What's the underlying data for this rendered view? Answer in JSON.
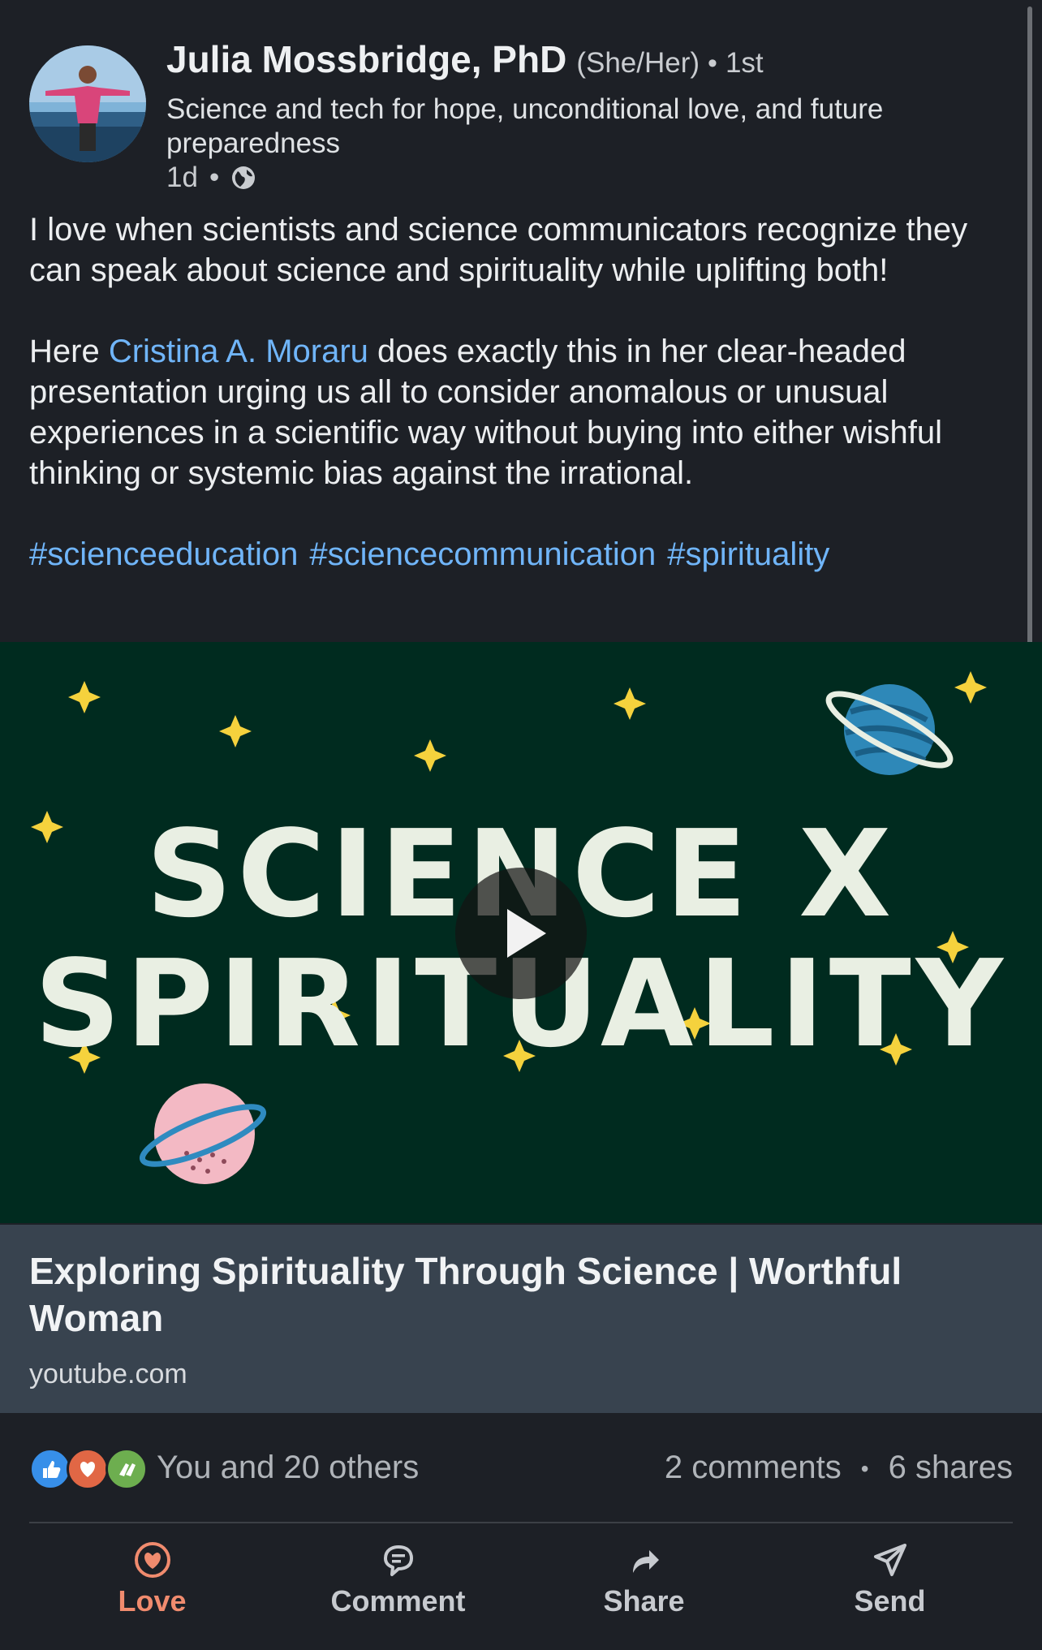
{
  "post": {
    "author": {
      "name": "Julia Mossbridge, PhD",
      "pronouns": "(She/Her)",
      "degree": "1st",
      "headline": "Science and tech for hope, unconditional love, and future preparedness",
      "time": "1d"
    },
    "body": {
      "paragraph1": "I love when scientists and science communicators recognize they can speak about science and spirituality while uplifting both!",
      "p2_before": "Here ",
      "mention": "Cristina A. Moraru",
      "p2_after": " does exactly this in her clear-headed presentation urging us all to consider anomalous or unusual experiences in a scientific way without buying into either wishful thinking or systemic bias against the irrational.",
      "hashtags": [
        "#scienceeducation",
        "#sciencecommunication",
        "#spirituality"
      ]
    },
    "media": {
      "line1": "SCIENCE X",
      "line2": "SPIRITUALITY",
      "bg_color": "#002b1f"
    },
    "link": {
      "title": "Exploring Spirituality Through Science | Worthful Woman",
      "source": "youtube.com"
    },
    "social": {
      "reactions_text": "You and 20 others",
      "comments": "2 comments",
      "shares": "6 shares",
      "reaction_icons": [
        "like-icon",
        "love-icon",
        "celebrate-icon"
      ]
    },
    "actions": [
      {
        "label": "Love",
        "icon": "heart-icon",
        "active": true
      },
      {
        "label": "Comment",
        "icon": "comment-icon",
        "active": false
      },
      {
        "label": "Share",
        "icon": "share-arrow-icon",
        "active": false
      },
      {
        "label": "Send",
        "icon": "send-icon",
        "active": false
      }
    ],
    "colors": {
      "background": "#1d2026",
      "link": "#70b5f9",
      "active_love": "#f08b6e"
    }
  }
}
